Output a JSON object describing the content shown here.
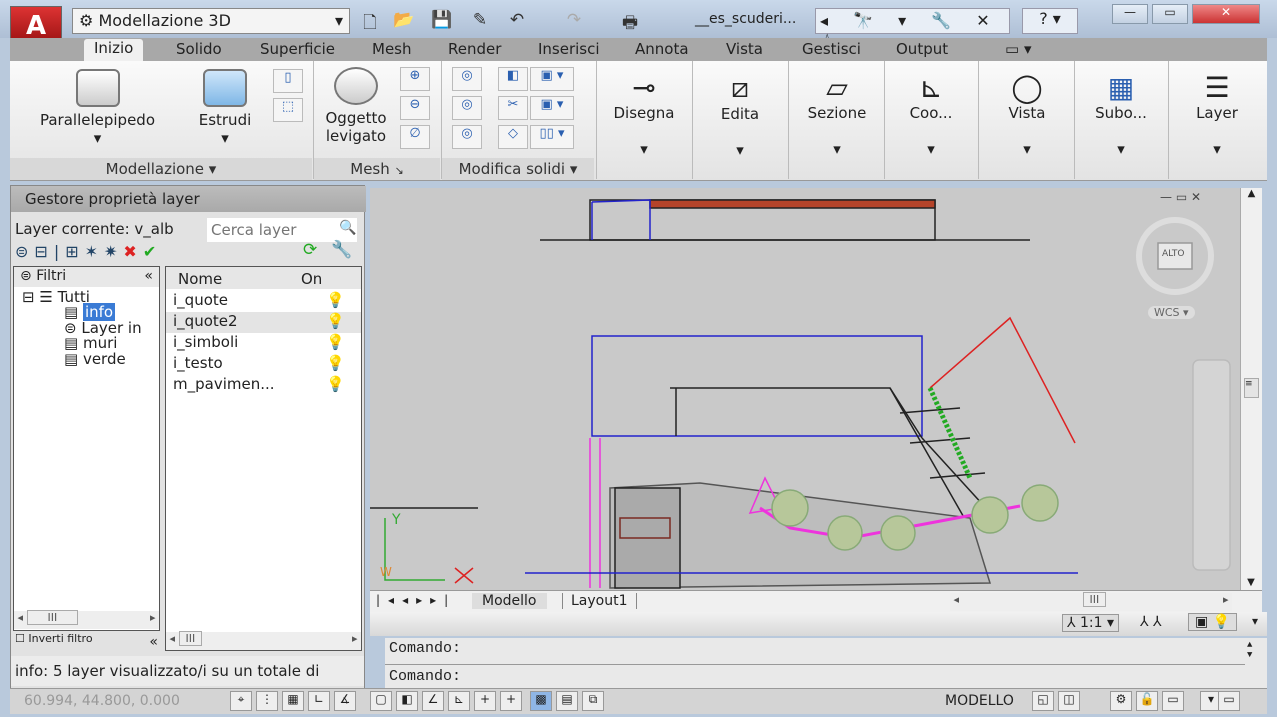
{
  "titlebar": {
    "workspace": "Modellazione 3D",
    "document_title": "__es_scuderi...",
    "help": "?",
    "qa_icons": [
      "new-icon",
      "open-icon",
      "save-icon",
      "save-as-icon",
      "undo-icon",
      "redo-icon",
      "plot-icon"
    ],
    "search_icons": "◂ 🔭 ▾ 🔧 ✕ ☆"
  },
  "ribbon": {
    "tabs": [
      "Inizio",
      "Solido",
      "Superficie",
      "Mesh",
      "Render",
      "Inserisci",
      "Annota",
      "Vista",
      "Gestisci",
      "Output"
    ],
    "active_tab": "Inizio",
    "buttons": {
      "box": "Parallelepipedo",
      "extrude": "Estrudi",
      "smooth": "Oggetto levigato",
      "draw": "Disegna",
      "edit": "Edita",
      "section": "Sezione",
      "coord": "Coo...",
      "view": "Vista",
      "subobj": "Subo...",
      "layer": "Layer"
    },
    "panels": {
      "modeling": "Modellazione ▾",
      "mesh": "Mesh",
      "modify": "Modifica solidi ▾"
    }
  },
  "palette": {
    "title": "Gestore proprietà layer",
    "current_layer": "Layer  corrente: v_alb",
    "search_placeholder": "Cerca layer",
    "filters_header": "Filtri",
    "tree": [
      "Tutti",
      "info",
      "Layer in",
      "muri",
      "verde"
    ],
    "selected_filter": "info",
    "invert_filter": "Inverti filtro",
    "columns": {
      "name": "Nome",
      "on": "On"
    },
    "layers": [
      "i_quote",
      "i_quote2",
      "i_simboli",
      "i_testo",
      "m_pavimen..."
    ],
    "status": "info: 5 layer visualizzato/i su un totale di"
  },
  "viewport": {
    "viewcube": "ALTO",
    "wcs": "WCS ▾",
    "ucs_y": "Y"
  },
  "layout_tabs": [
    "Modello",
    "Layout1"
  ],
  "annotation": {
    "scale": "1:1 ▾"
  },
  "command": {
    "line1": "Comando:",
    "line2": "Comando:"
  },
  "statusbar": {
    "coords": "60.994, 44.800, 0.000",
    "mode": "MODELLO"
  },
  "colors": {
    "accent": "#3a7bd5",
    "canvas": "#c9c9c9"
  }
}
